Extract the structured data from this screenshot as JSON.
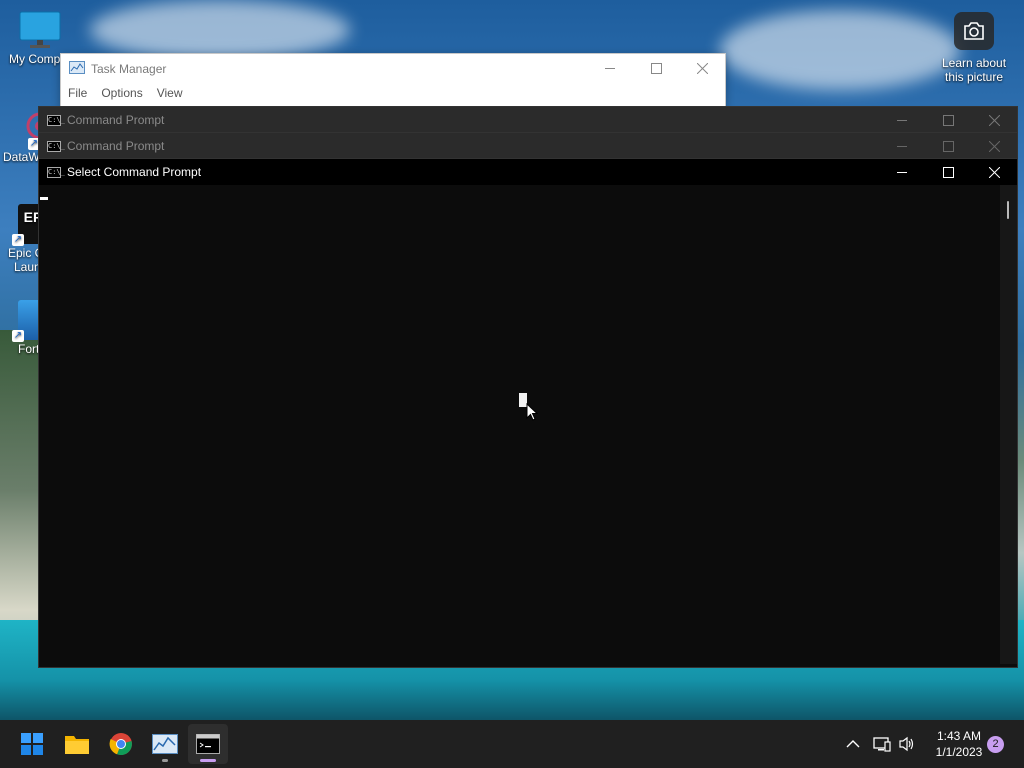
{
  "desktop": {
    "icons": [
      {
        "label": "My Compu",
        "icon": "monitor-icon"
      },
      {
        "label": "DataW",
        "icon": "datawrapper-icon"
      },
      {
        "label": "Epic G Laun",
        "line1": "Epic G",
        "line2": "Laun",
        "icon": "epic-games-icon",
        "badge": "EP"
      },
      {
        "label": "Fort",
        "icon": "fortnite-icon"
      }
    ],
    "spotlight": {
      "line1": "Learn about",
      "line2": "this picture",
      "icon": "camera-icon"
    }
  },
  "task_manager": {
    "title": "Task Manager",
    "menu": [
      "File",
      "Options",
      "View"
    ]
  },
  "cmd_windows": [
    {
      "title": "Command Prompt",
      "state": "inactive"
    },
    {
      "title": "Command Prompt",
      "state": "inactive"
    },
    {
      "title": "Select Command Prompt",
      "state": "active"
    }
  ],
  "cmd_icon_text": "C:\\_",
  "taskbar": {
    "apps": [
      "start-icon",
      "file-explorer-icon",
      "chrome-icon",
      "task-manager-icon",
      "command-prompt-icon"
    ],
    "clock": {
      "time": "1:43 AM",
      "date": "1/1/2023"
    },
    "notification_count": "2"
  },
  "colors": {
    "taskbar": "#202020",
    "console_bg": "#0c0c0c",
    "accent_indicator": "#c89ef0",
    "start_blue": "#0078d4"
  }
}
